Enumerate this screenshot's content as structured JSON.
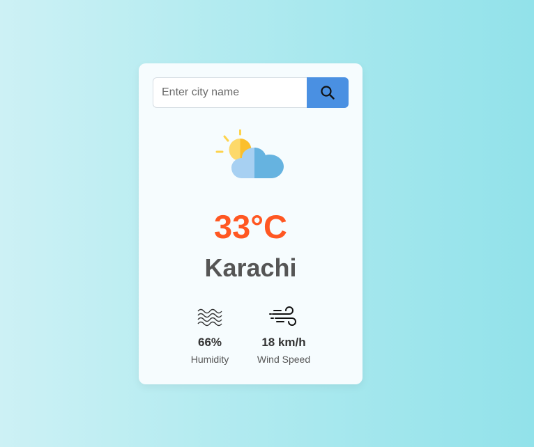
{
  "search": {
    "placeholder": "Enter city name",
    "value": "",
    "button_icon": "search-icon"
  },
  "weather": {
    "icon": "partly-cloudy-icon",
    "temperature": "33°C",
    "city": "Karachi"
  },
  "stats": {
    "humidity": {
      "icon": "humidity-waves-icon",
      "value": "66%",
      "label": "Humidity"
    },
    "wind": {
      "icon": "wind-icon",
      "value": "18 km/h",
      "label": "Wind Speed"
    }
  },
  "colors": {
    "accent": "#4a90e2",
    "temperature": "#ff5722",
    "city": "#555555"
  }
}
